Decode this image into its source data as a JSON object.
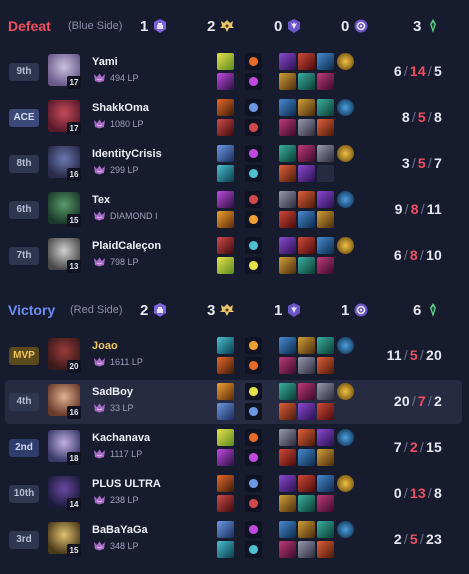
{
  "teams": [
    {
      "result": "Defeat",
      "side": "(Blue Side)",
      "result_color": "#ef4e62",
      "objectives": {
        "towers": "1",
        "dragons": "2",
        "barons": "0",
        "heralds": "0",
        "kills": "3"
      },
      "players": [
        {
          "rank": "9th",
          "rank_style": "normal",
          "name": "Yami",
          "level": "17",
          "lp": "494 LP",
          "k": "6",
          "d": "14",
          "a": "5",
          "highlight": false,
          "avatar": [
            "#6a5a8a",
            "#c9c2e0"
          ]
        },
        {
          "rank": "ACE",
          "rank_style": "ace",
          "name": "ShakkOma",
          "level": "17",
          "lp": "1080 LP",
          "k": "8",
          "d": "5",
          "a": "8",
          "highlight": false,
          "avatar": [
            "#5a1a2a",
            "#c44a5a"
          ]
        },
        {
          "rank": "8th",
          "rank_style": "normal",
          "name": "IdentityCrisis",
          "level": "16",
          "lp": "299 LP",
          "k": "3",
          "d": "5",
          "a": "7",
          "highlight": false,
          "avatar": [
            "#2a2a4a",
            "#6a78b0"
          ]
        },
        {
          "rank": "6th",
          "rank_style": "normal",
          "name": "Tex",
          "level": "15",
          "lp": "DIAMOND I",
          "k": "9",
          "d": "8",
          "a": "11",
          "highlight": false,
          "avatar": [
            "#1a3a2a",
            "#5a9a6a"
          ]
        },
        {
          "rank": "7th",
          "rank_style": "normal",
          "name": "PlaidCaleçon",
          "level": "13",
          "lp": "798 LP",
          "k": "6",
          "d": "8",
          "a": "10",
          "highlight": false,
          "avatar": [
            "#4a4a4a",
            "#d0d0d0"
          ]
        }
      ]
    },
    {
      "result": "Victory",
      "side": "(Red Side)",
      "result_color": "#6a8ff0",
      "objectives": {
        "towers": "2",
        "dragons": "3",
        "barons": "1",
        "heralds": "1",
        "kills": "6"
      },
      "players": [
        {
          "rank": "MVP",
          "rank_style": "mvp",
          "name": "Joao",
          "level": "20",
          "lp": "1611 LP",
          "k": "11",
          "d": "5",
          "a": "20",
          "highlight": false,
          "avatar": [
            "#3a1a1a",
            "#9a3a3a"
          ]
        },
        {
          "rank": "4th",
          "rank_style": "normal",
          "name": "SadBoy",
          "level": "16",
          "lp": "33 LP",
          "k": "20",
          "d": "7",
          "a": "2",
          "highlight": true,
          "avatar": [
            "#6a3a2a",
            "#e0b090"
          ]
        },
        {
          "rank": "2nd",
          "rank_style": "second",
          "name": "Kachanava",
          "level": "18",
          "lp": "1117 LP",
          "k": "7",
          "d": "2",
          "a": "15",
          "highlight": false,
          "avatar": [
            "#3a3a6a",
            "#c0b0e0"
          ]
        },
        {
          "rank": "10th",
          "rank_style": "normal",
          "name": "PLUS ULTRA",
          "level": "14",
          "lp": "238 LP",
          "k": "0",
          "d": "13",
          "a": "8",
          "highlight": false,
          "avatar": [
            "#1a1a3a",
            "#6a4aa0"
          ]
        },
        {
          "rank": "3rd",
          "rank_style": "normal",
          "name": "BaBaYaGa",
          "level": "15",
          "lp": "348 LP",
          "k": "2",
          "d": "5",
          "a": "23",
          "highlight": false,
          "avatar": [
            "#4a3a1a",
            "#e0c070"
          ]
        }
      ]
    }
  ],
  "icons": {
    "tower": "tower-icon",
    "dragon": "dragon-icon",
    "baron": "baron-icon",
    "herald": "herald-icon",
    "kills": "kill-icon",
    "lp": "rank-emblem-icon"
  },
  "colors": {
    "background": "#171b2e",
    "death": "#ef4e62",
    "objective_purple": "#8f73f0",
    "objective_gold": "#e8c46a",
    "kills_green": "#5ad08a"
  }
}
